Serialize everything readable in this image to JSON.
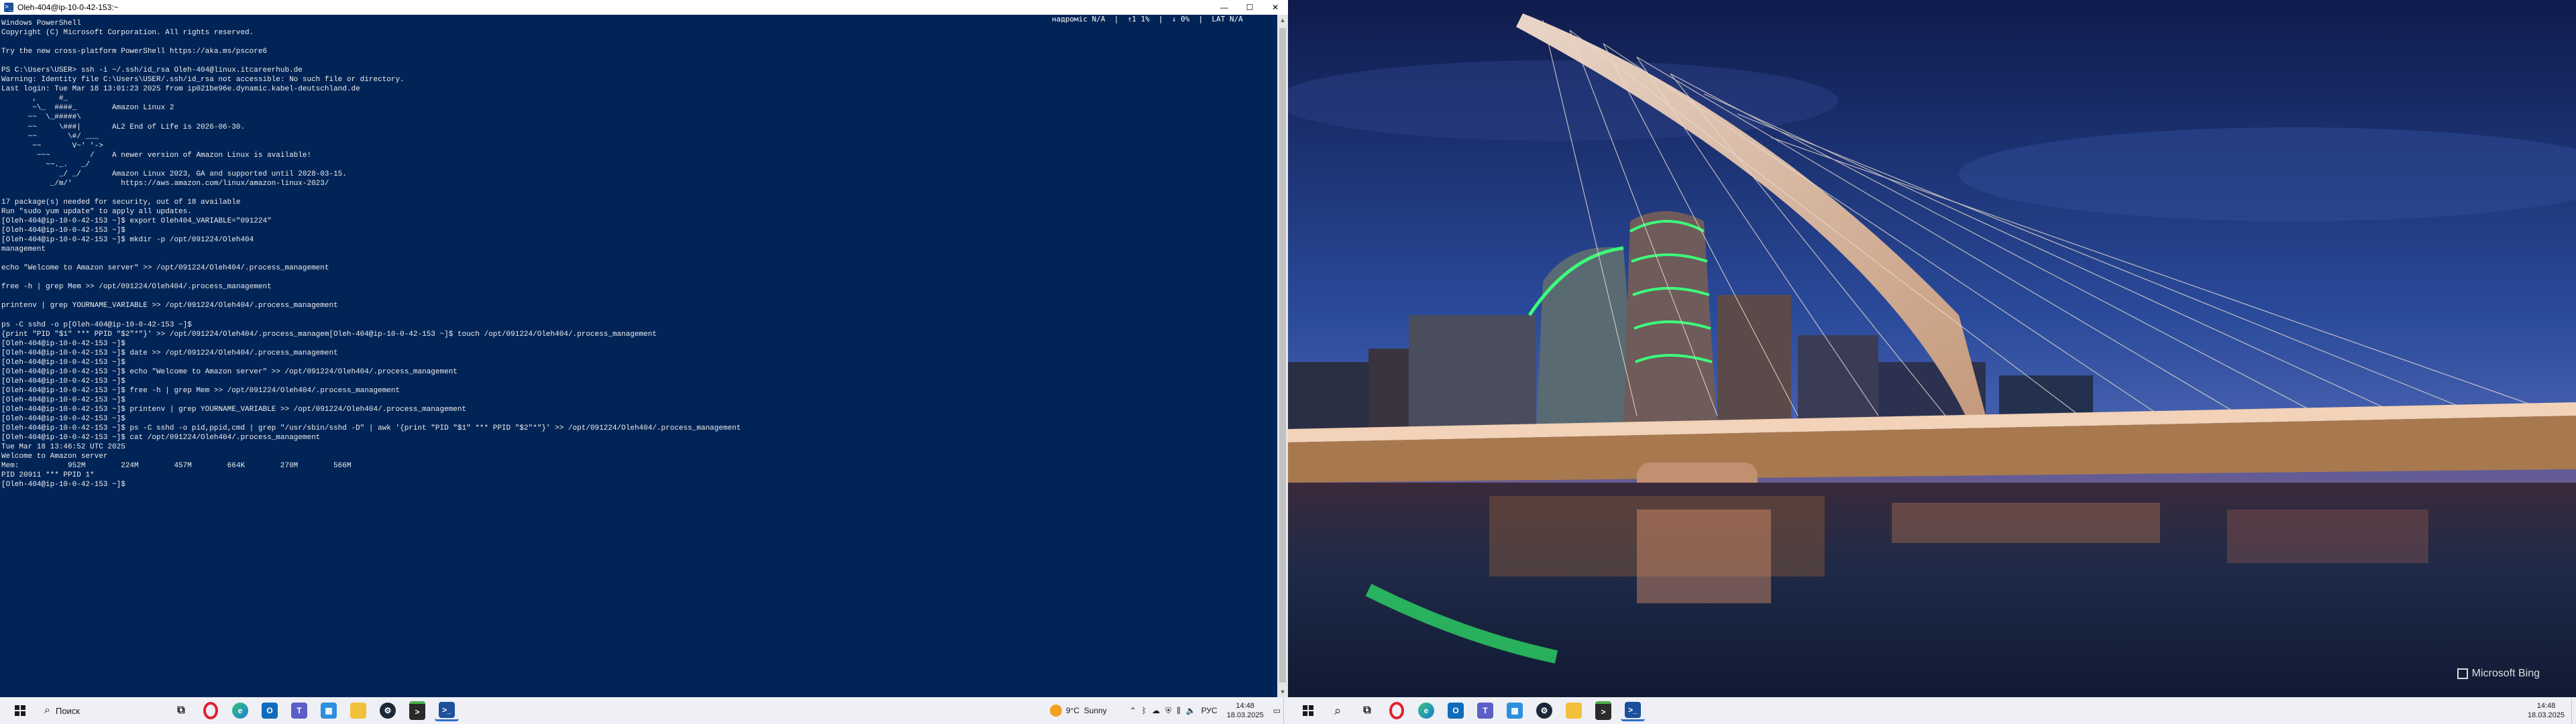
{
  "left_window": {
    "title": "Oleh-404@ip-10-0-42-153:~",
    "controls": {
      "minimize": "—",
      "maximize": "☐",
      "close": "✕"
    },
    "status_line": "надроміс N/A  |  ↑1 1%  |  ↓ 0%  |  LAT N/A"
  },
  "console_lines": [
    "Windows PowerShell",
    "Copyright (C) Microsoft Corporation. All rights reserved.",
    "",
    "Try the new cross-platform PowerShell https://aka.ms/pscore6",
    "",
    "PS C:\\Users\\USER> ssh -i ~/.ssh/id_rsa Oleh-404@linux.itcareerhub.de",
    "Warning: Identity file C:\\Users\\USER/.ssh/id_rsa not accessible: No such file or directory.",
    "Last login: Tue Mar 18 13:01:23 2025 from ip021be96e.dynamic.kabel-deutschland.de",
    "       ,     #_",
    "       ~\\_  ####_        Amazon Linux 2",
    "      ~~  \\_#####\\",
    "      ~~     \\###|       AL2 End of Life is 2026-06-30.",
    "      ~~       \\#/ ___",
    "       ~~       V~' '->",
    "        ~~~         /    A newer version of Amazon Linux is available!",
    "          ~~._.   _/",
    "             _/ _/       Amazon Linux 2023, GA and supported until 2028-03-15.",
    "           _/m/'           https://aws.amazon.com/linux/amazon-linux-2023/",
    "",
    "17 package(s) needed for security, out of 18 available",
    "Run \"sudo yum update\" to apply all updates.",
    "[Oleh-404@ip-10-0-42-153 ~]$ export Oleh404_VARIABLE=\"091224\"",
    "[Oleh-404@ip-10-0-42-153 ~]$",
    "[Oleh-404@ip-10-0-42-153 ~]$ mkdir -p /opt/091224/Oleh404",
    "management",
    "",
    "echo \"Welcome to Amazon server\" >> /opt/091224/Oleh404/.process_management",
    "",
    "free -h | grep Mem >> /opt/091224/Oleh404/.process_management",
    "",
    "printenv | grep YOURNAME_VARIABLE >> /opt/091224/Oleh404/.process_management",
    "",
    "ps -C sshd -o p[Oleh-404@ip-10-0-42-153 ~]$",
    "{print \"PID \"$1\" *** PPID \"$2\"*\"}' >> /opt/091224/Oleh404/.process_managem[Oleh-404@ip-10-0-42-153 ~]$ touch /opt/091224/Oleh404/.process_management",
    "[Oleh-404@ip-10-0-42-153 ~]$",
    "[Oleh-404@ip-10-0-42-153 ~]$ date >> /opt/091224/Oleh404/.process_management",
    "[Oleh-404@ip-10-0-42-153 ~]$",
    "[Oleh-404@ip-10-0-42-153 ~]$ echo \"Welcome to Amazon server\" >> /opt/091224/Oleh404/.process_management",
    "[Oleh-404@ip-10-0-42-153 ~]$",
    "[Oleh-404@ip-10-0-42-153 ~]$ free -h | grep Mem >> /opt/091224/Oleh404/.process_management",
    "[Oleh-404@ip-10-0-42-153 ~]$",
    "[Oleh-404@ip-10-0-42-153 ~]$ printenv | grep YOURNAME_VARIABLE >> /opt/091224/Oleh404/.process_management",
    "[Oleh-404@ip-10-0-42-153 ~]$",
    "[Oleh-404@ip-10-0-42-153 ~]$ ps -C sshd -o pid,ppid,cmd | grep \"/usr/sbin/sshd -D\" | awk '{print \"PID \"$1\" *** PPID \"$2\"*\"}' >> /opt/091224/Oleh404/.process_management",
    "[Oleh-404@ip-10-0-42-153 ~]$ cat /opt/091224/Oleh404/.process_management",
    "Tue Mar 18 13:46:52 UTC 2025",
    "Welcome to Amazon server",
    "Mem:           952M        224M        457M        664K        270M        566M",
    "PID 20911 *** PPID 1*",
    "[Oleh-404@ip-10-0-42-153 ~]$"
  ],
  "taskbar_left": {
    "search_label": "Поиск",
    "apps": [
      "start",
      "search",
      "task-view",
      "opera",
      "edge",
      "outlook",
      "teams",
      "store",
      "file-explorer",
      "steam",
      "terminal",
      "powershell"
    ],
    "weather_temp": "9°C",
    "weather_text": "Sunny",
    "lang": "РУС",
    "time": "14:48",
    "date": "18.03.2025"
  },
  "taskbar_right": {
    "time": "14:48",
    "date": "18.03.2025"
  },
  "wallpaper": {
    "watermark": "Microsoft Bing"
  },
  "colors": {
    "console_bg": "#012456",
    "console_fg": "#eeeeee",
    "taskbar_bg": "#eef0f5",
    "accent": "#2f6fce"
  }
}
